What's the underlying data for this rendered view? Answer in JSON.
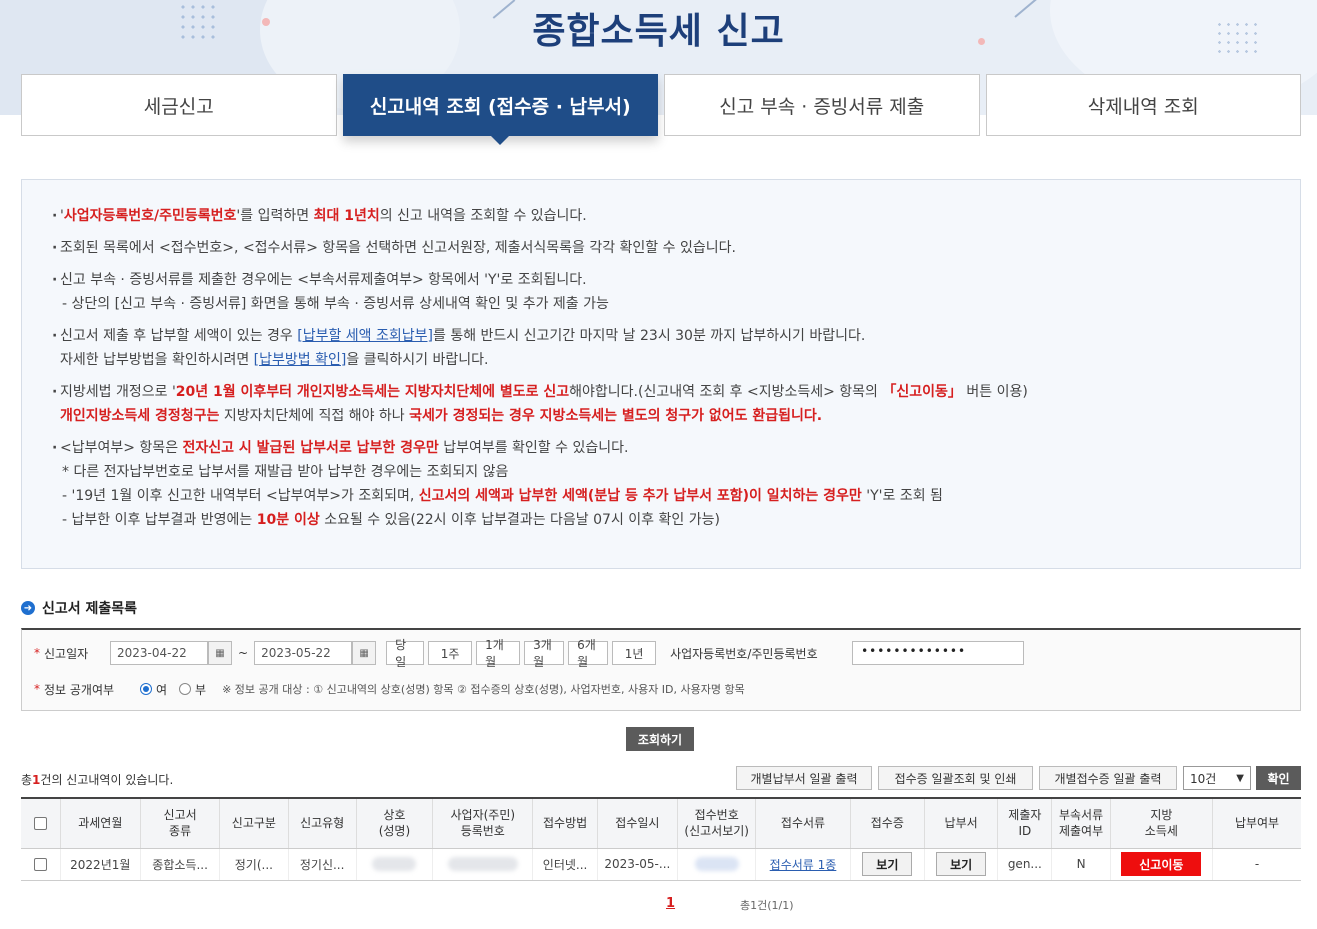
{
  "page_title": "종합소득세 신고",
  "tabs": [
    {
      "label": "세금신고",
      "active": false
    },
    {
      "label": "신고내역 조회 (접수증 · 납부서)",
      "active": true
    },
    {
      "label": "신고 부속 · 증빙서류 제출",
      "active": false
    },
    {
      "label": "삭제내역 조회",
      "active": false
    }
  ],
  "notice": {
    "n1_a": "'",
    "n1_red1": "사업자등록번호/주민등록번호",
    "n1_b": "'를 입력하면 ",
    "n1_red2": "최대 1년치",
    "n1_c": "의 신고 내역을 조회할 수 있습니다.",
    "n2": "조회된 목록에서 <접수번호>, <접수서류> 항목을 선택하면 신고서원장, 제출서식목록을 각각 확인할 수 있습니다.",
    "n3": "신고 부속 · 증빙서류를 제출한 경우에는 <부속서류제출여부> 항목에서 'Y'로 조회됩니다.",
    "n3_sub": "- 상단의 [신고 부속 · 증빙서류] 화면을 통해 부속 · 증빙서류 상세내역 확인 및 추가 제출 가능",
    "n4_a": "신고서 제출 후 납부할 세액이 있는 경우 ",
    "n4_link1": "[납부할 세액 조회납부]",
    "n4_b": "를 통해 반드시 신고기간 마지막 날 23시 30분 까지 납부하시기 바랍니다.",
    "n4_c": "자세한 납부방법을 확인하시려면 ",
    "n4_link2": "[납부방법 확인]",
    "n4_d": "을 클릭하시기 바랍니다.",
    "n5_a": "지방세법 개정으로 '",
    "n5_red1": "20년 1월 이후부터 개인지방소득세는 지방자치단체에 별도로 신고",
    "n5_b": "해야합니다.(신고내역 조회 후 <지방소득세> 항목의 ",
    "n5_red2": "「신고이동」",
    "n5_c": " 버튼 이용)",
    "n5_red3": "개인지방소득세 경정청구는",
    "n5_d": " 지방자치단체에 직접 해야 하나 ",
    "n5_red4": "국세가 경정되는 경우 지방소득세는 별도의 청구가 없어도 환급됩니다.",
    "n6_a": "<납부여부> 항목은 ",
    "n6_red1": "전자신고 시 발급된 납부서로 납부한 경우만",
    "n6_b": " 납부여부를 확인할 수 있습니다.",
    "n6_sub1": " * 다른 전자납부번호로 납부서를 재발급 받아 납부한 경우에는 조회되지 않음",
    "n6_sub2_a": "- '19년 1월 이후 신고한 내역부터 <납부여부>가 조회되며, ",
    "n6_sub2_red": "신고서의 세액과 납부한 세액(분납 등 추가 납부서 포함)이 일치하는 경우만",
    "n6_sub2_b": " 'Y'로 조회 됨",
    "n6_sub3_a": "- 납부한 이후 납부결과 반영에는 ",
    "n6_sub3_red": "10분 이상",
    "n6_sub3_b": " 소요될 수 있음(22시 이후 납부결과는 다음날 07시 이후 확인 가능)"
  },
  "section_title": "신고서 제출목록",
  "search": {
    "date_label": "신고일자",
    "date_from": "2023-04-22",
    "date_to": "2023-05-22",
    "tilde": "~",
    "periods": [
      "당일",
      "1주",
      "1개월",
      "3개월",
      "6개월",
      "1년"
    ],
    "id_label": "사업자등록번호/주민등록번호",
    "id_value": "•••••••••••••",
    "disclose_label": "정보 공개여부",
    "yes": "여",
    "no": "부",
    "disclose_note": "※ 정보 공개 대상 : ① 신고내역의 상호(성명) 항목 ② 접수증의 상호(성명), 사업자번호, 사용자 ID, 사용자명 항목"
  },
  "query_button": "조회하기",
  "total": {
    "prefix": "총",
    "count": "1",
    "suffix": "건의 신고내역이 있습니다."
  },
  "toolbar": {
    "btn1": "개별납부서 일괄 출력",
    "btn2": "접수증 일괄조회 및 인쇄",
    "btn3": "개별접수증 일괄 출력",
    "page_size": "10건",
    "confirm": "확인"
  },
  "table": {
    "headers": [
      "과세연월",
      "신고서\n종류",
      "신고구분",
      "신고유형",
      "상호\n(성명)",
      "사업자(주민)\n등록번호",
      "접수방법",
      "접수일시",
      "접수번호\n(신고서보기)",
      "접수서류",
      "접수증",
      "납부서",
      "제출자\nID",
      "부속서류\n제출여부",
      "지방\n소득세",
      "납부여부"
    ],
    "row": {
      "period": "2022년1월",
      "kind": "종합소득...",
      "category": "정기(...",
      "type": "정기신...",
      "method": "인터넷...",
      "datetime": "2023-05-...",
      "docs": "접수서류 1종",
      "receipt": "보기",
      "bill": "보기",
      "submitter": "gen...",
      "attach": "N",
      "local_tax": "신고이동",
      "paid": "-"
    }
  },
  "pager": {
    "current": "1",
    "total": "총1건(1/1)"
  }
}
